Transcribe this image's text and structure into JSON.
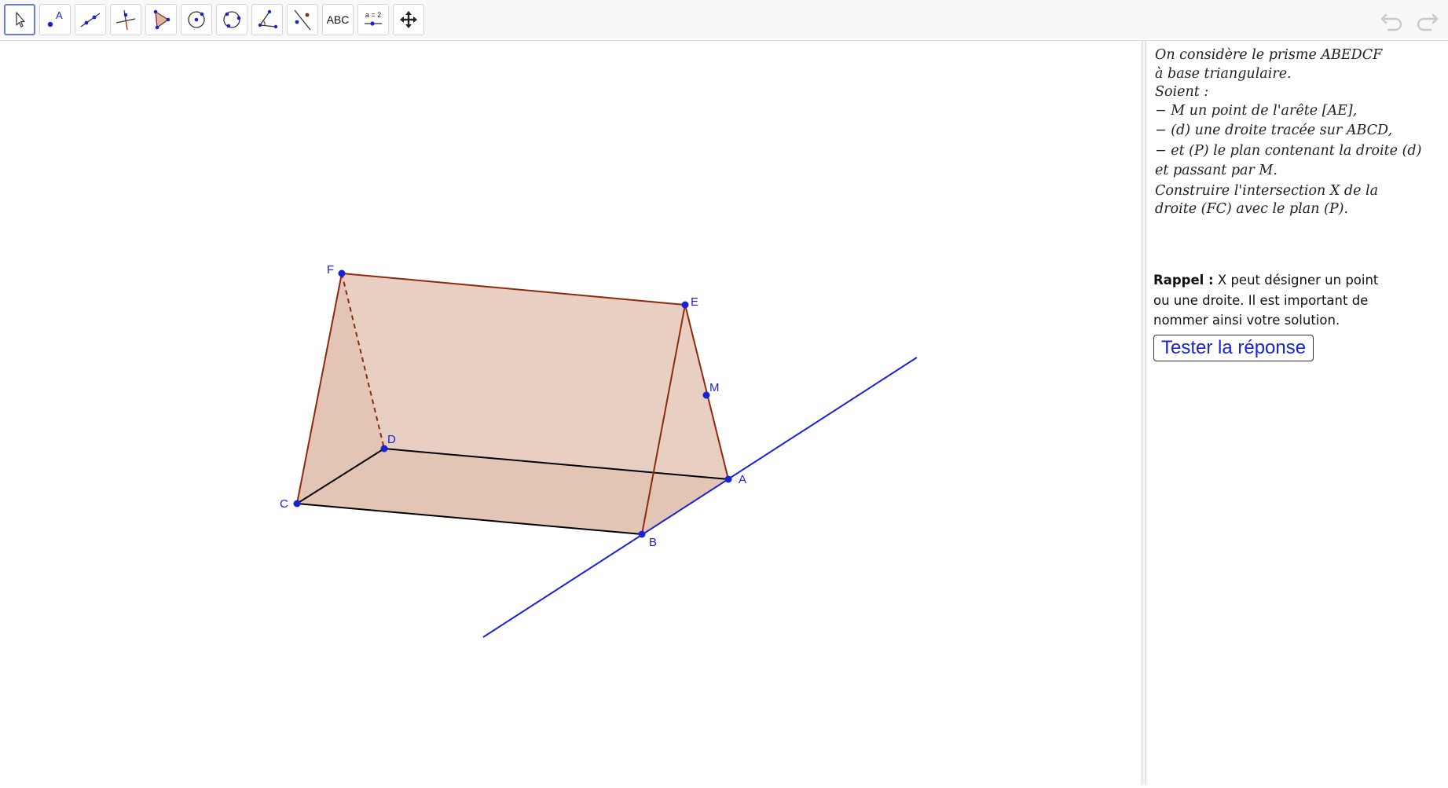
{
  "toolbar": {
    "tools": [
      {
        "name": "move-tool-icon",
        "active": true
      },
      {
        "name": "point-tool-icon",
        "label": "A"
      },
      {
        "name": "line-tool-icon"
      },
      {
        "name": "perpendicular-line-tool-icon"
      },
      {
        "name": "polygon-tool-icon"
      },
      {
        "name": "circle-center-point-tool-icon"
      },
      {
        "name": "circle-three-points-tool-icon"
      },
      {
        "name": "angle-tool-icon"
      },
      {
        "name": "reflect-tool-icon"
      },
      {
        "name": "text-tool-icon",
        "label": "ABC"
      },
      {
        "name": "slider-tool-icon",
        "label": "a = 2"
      },
      {
        "name": "move-graphics-view-tool-icon"
      }
    ],
    "undo_icon": "undo-icon",
    "redo_icon": "redo-icon"
  },
  "figure": {
    "colors": {
      "face_fill": "#dcb7a4",
      "edge": "#8c2a0e",
      "base_edge": "#000000",
      "point": "#1a22d6",
      "line_d": "#1a22d6"
    },
    "points": {
      "A": "A",
      "B": "B",
      "C": "C",
      "D": "D",
      "E": "E",
      "F": "F",
      "M": "M"
    }
  },
  "panel": {
    "statement": [
      "On considère le prisme ABEDCF",
      "à base triangulaire.",
      "Soient :",
      "− M un point de l'arête [AE],",
      "− (d) une droite tracée sur ABCD,",
      "− et (P) le plan contenant la droite (d)",
      "et passant par M.",
      "Construire l'intersection X de la",
      "droite (FC) avec le plan (P)."
    ],
    "reminder": {
      "title": "Rappel :",
      "line1": " X peut désigner un point",
      "line2": "ou une droite. Il est important de",
      "line3": "nommer ainsi votre solution."
    },
    "test_button": "Tester la réponse"
  }
}
